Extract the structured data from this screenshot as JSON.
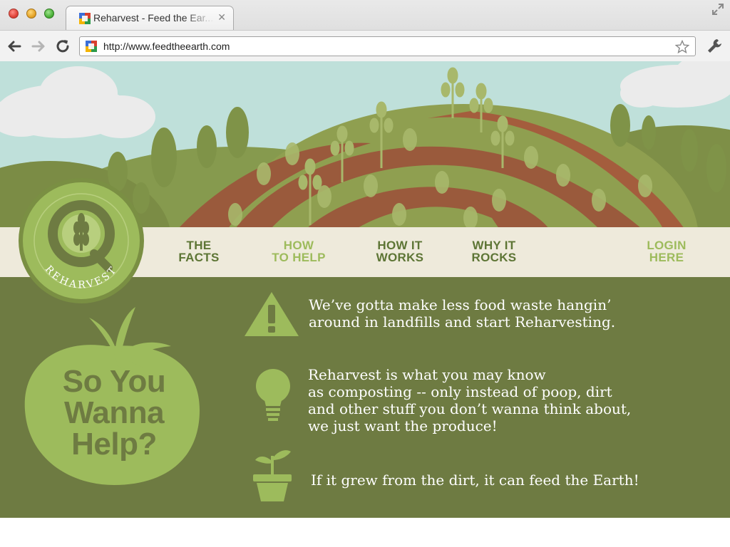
{
  "browser": {
    "tab_title": "Reharvest - Feed the Ear...",
    "tab_close": "✕",
    "url": "http://www.feedtheearth.com"
  },
  "site": {
    "logo_text": "REHARVEST",
    "nav": [
      {
        "line1": "THE",
        "line2": "FACTS"
      },
      {
        "line1": "HOW",
        "line2": "TO HELP"
      },
      {
        "line1": "HOW IT",
        "line2": "WORKS"
      },
      {
        "line1": "WHY IT",
        "line2": "ROCKS"
      },
      {
        "line1": "LOGIN",
        "line2": "HERE"
      }
    ],
    "promo": {
      "line1": "So You",
      "line2": "Wanna",
      "line3": "Help?"
    },
    "info": [
      {
        "icon": "warning-icon",
        "lines": [
          "We’ve gotta make less food waste hangin’",
          " around in landfills and start Reharvesting."
        ]
      },
      {
        "icon": "lightbulb-icon",
        "lines": [
          "Reharvest is what you may know",
          "as composting -- only instead of poop, dirt",
          "and other stuff you don’t wanna think about,",
          "we just want the produce!"
        ]
      },
      {
        "icon": "sprout-pot-icon",
        "lines": [
          "If it grew from the dirt, it can feed the Earth!"
        ]
      }
    ]
  },
  "colors": {
    "sky": "#bfe0da",
    "panel_green": "#6e7b42",
    "nav_dark": "#5d7535",
    "nav_light": "#9dbb5c",
    "light_green": "#9dbb5c",
    "band": "#eeeadb",
    "field_red": "#9a5a3c"
  }
}
